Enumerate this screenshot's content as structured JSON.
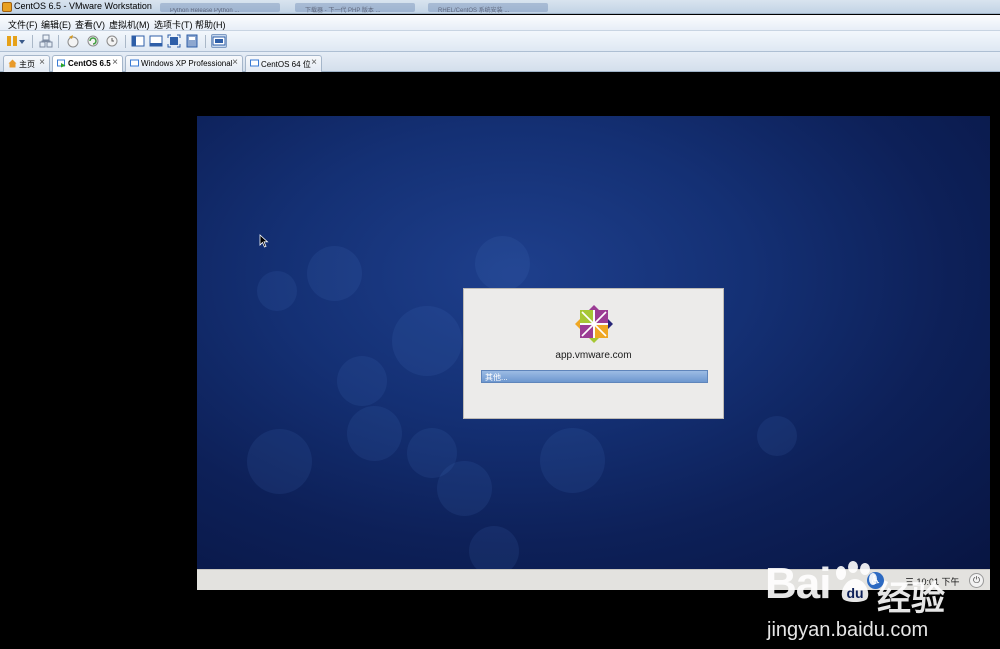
{
  "window": {
    "title": "CentOS 6.5 - VMware Workstation",
    "background_titles": [
      "Python Release Python ...",
      "下载器 - 下一代 PHP 版本 ...",
      "RHEL/CentOS 系统安装 ..."
    ]
  },
  "menu": {
    "items": [
      {
        "label": "文件(F)"
      },
      {
        "label": "编辑(E)"
      },
      {
        "label": "查看(V)"
      },
      {
        "label": "虚拟机(M)"
      },
      {
        "label": "选项卡(T)"
      },
      {
        "label": "帮助(H)"
      }
    ]
  },
  "toolbar": {
    "buttons": [
      {
        "icon": "pause-icon",
        "color": "#e6a21a"
      },
      {
        "icon": "dropdown-icon",
        "color": "#3a5a8a"
      },
      {
        "icon": "network-icon",
        "color": "#7c8aa0"
      },
      {
        "icon": "snapshot-icon",
        "color": "#d49a22"
      },
      {
        "icon": "revert-snapshot-icon",
        "color": "#3a9a3a"
      },
      {
        "icon": "snapshot-manager-icon",
        "color": "#8a8a8a"
      },
      {
        "icon": "sidebar-icon",
        "color": "#2f5fa8"
      },
      {
        "icon": "console-icon",
        "color": "#2f5fa8"
      },
      {
        "icon": "fullscreen-icon",
        "color": "#2f5fa8"
      },
      {
        "icon": "unity-icon",
        "color": "#2f5fa8"
      },
      {
        "icon": "view-icon",
        "color": "#2f5fa8"
      }
    ]
  },
  "tabs": [
    {
      "label": "主页",
      "icon": "home-icon",
      "close": "×",
      "active": false
    },
    {
      "label": "CentOS 6.5",
      "icon": "vm-icon",
      "close": "×",
      "active": true
    },
    {
      "label": "Windows XP Professional",
      "icon": "vm-icon",
      "close": "×",
      "active": false
    },
    {
      "label": "CentOS 64 位",
      "icon": "vm-icon",
      "close": "×",
      "active": false
    }
  ],
  "login": {
    "hostname": "app.vmware.com",
    "user_entry": "其他...",
    "logo_colors": [
      "#a6c734",
      "#9b3c94",
      "#efa724",
      "#262577"
    ]
  },
  "panel": {
    "a11y_icon": "accessibility-icon",
    "a11y_glyph": "♿",
    "clock": "三 10:01 下午",
    "power_icon": "power-icon",
    "power_glyph": "⏻"
  },
  "watermark": {
    "logo": "Bai",
    "logo_suffix": "经验",
    "url": "jingyan.baidu.com"
  }
}
